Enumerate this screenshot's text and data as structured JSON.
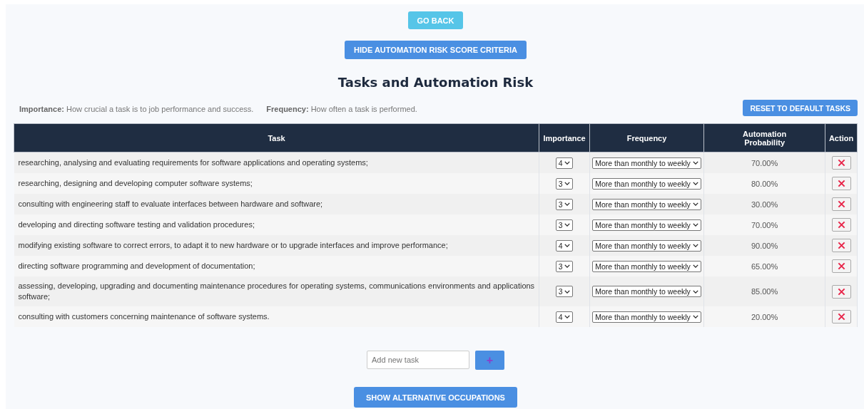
{
  "buttons_top": [
    "GO BACK",
    "HIDE AUTOMATION RISK SCORE CRITERIA"
  ],
  "title": "Tasks and Automation Risk",
  "legend": [
    {
      "term": "Importance:",
      "text": "How crucial a task is to job performance and success."
    },
    {
      "term": "Frequency:",
      "text": "How often a task is performed."
    }
  ],
  "reset_button": "RESET TO DEFAULT TASKS",
  "table": {
    "columns": [
      "Task",
      "Importance",
      "Frequency",
      "Automation Probability",
      "Action"
    ],
    "rows": [
      {
        "task": "researching, analysing and evaluating requirements for software applications and operating systems;",
        "importance": "4",
        "frequency": "More than monthly to weekly",
        "probability": "70.00%"
      },
      {
        "task": "researching, designing and developing computer software systems;",
        "importance": "3",
        "frequency": "More than monthly to weekly",
        "probability": "80.00%"
      },
      {
        "task": "consulting with engineering staff to evaluate interfaces between hardware and software;",
        "importance": "3",
        "frequency": "More than monthly to weekly",
        "probability": "30.00%"
      },
      {
        "task": "developing and directing software testing and validation procedures;",
        "importance": "3",
        "frequency": "More than monthly to weekly",
        "probability": "70.00%"
      },
      {
        "task": "modifying existing software to correct errors, to adapt it to new hardware or to upgrade interfaces and improve performance;",
        "importance": "4",
        "frequency": "More than monthly to weekly",
        "probability": "90.00%"
      },
      {
        "task": "directing software programming and development of documentation;",
        "importance": "3",
        "frequency": "More than monthly to weekly",
        "probability": "65.00%"
      },
      {
        "task": "assessing, developing, upgrading and documenting maintenance procedures for operating systems, communications environments and applications software;",
        "importance": "3",
        "frequency": "More than monthly to weekly",
        "probability": "85.00%"
      },
      {
        "task": "consulting with customers concerning maintenance of software systems.",
        "importance": "4",
        "frequency": "More than monthly to weekly",
        "probability": "20.00%"
      }
    ]
  },
  "add_task": {
    "placeholder": "Add new task",
    "button": "+"
  },
  "bottom_button": "SHOW ALTERNATIVE OCCUPATIONS"
}
